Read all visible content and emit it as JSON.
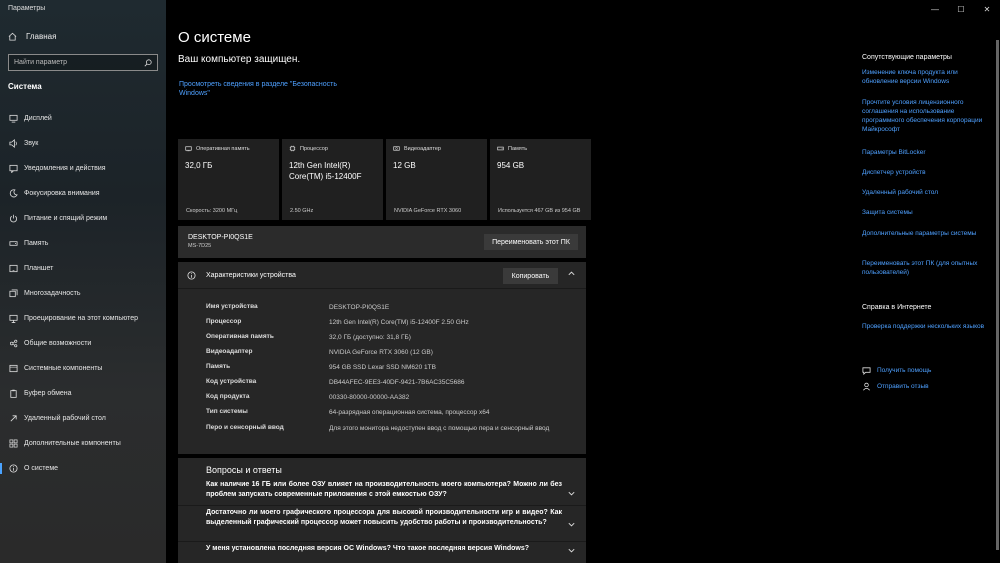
{
  "app": {
    "title": "Параметры"
  },
  "window": {
    "minimize": "—",
    "maximize": "☐",
    "close": "✕"
  },
  "sidebar": {
    "home_label": "Главная",
    "search_placeholder": "Найти параметр",
    "section_title": "Система",
    "items": [
      {
        "label": "Дисплей",
        "icon": "monitor-icon"
      },
      {
        "label": "Звук",
        "icon": "speaker-icon"
      },
      {
        "label": "Уведомления и действия",
        "icon": "notification-icon"
      },
      {
        "label": "Фокусировка внимания",
        "icon": "moon-icon"
      },
      {
        "label": "Питание и спящий режим",
        "icon": "power-icon"
      },
      {
        "label": "Память",
        "icon": "storage-icon"
      },
      {
        "label": "Планшет",
        "icon": "tablet-icon"
      },
      {
        "label": "Многозадачность",
        "icon": "multitask-icon"
      },
      {
        "label": "Проецирование на этот компьютер",
        "icon": "project-icon"
      },
      {
        "label": "Общие возможности",
        "icon": "shared-icon"
      },
      {
        "label": "Системные компоненты",
        "icon": "components-icon"
      },
      {
        "label": "Буфер обмена",
        "icon": "clipboard-icon"
      },
      {
        "label": "Удаленный рабочий стол",
        "icon": "remote-icon"
      },
      {
        "label": "Дополнительные компоненты",
        "icon": "grid-icon"
      },
      {
        "label": "О системе",
        "icon": "info-icon"
      }
    ]
  },
  "main": {
    "title": "О системе",
    "protected_text": "Ваш компьютер защищен.",
    "security_link": "Просмотреть сведения в разделе \"Безопасность Windows\"",
    "cards": [
      {
        "header": "Оперативная память",
        "value": "32,0 ГБ",
        "sub": "Скорость: 3200 МГц"
      },
      {
        "header": "Процессор",
        "value": "12th Gen Intel(R) Core(TM) i5-12400F",
        "sub": "2.50 GHz"
      },
      {
        "header": "Видеоадаптер",
        "value": "12 GB",
        "sub": "NVIDIA GeForce RTX 3060"
      },
      {
        "header": "Память",
        "value": "954 GB",
        "sub": "Используется 467 GB из 954 GB"
      }
    ],
    "pc_name": "DESKTOP-PI0QS1E",
    "pc_model": "MS-7D25",
    "rename_button": "Переименовать этот ПК",
    "specs_title": "Характеристики устройства",
    "copy_button": "Копировать",
    "specs": [
      {
        "key": "Имя устройства",
        "value": "DESKTOP-PI0QS1E"
      },
      {
        "key": "Процессор",
        "value": "12th Gen Intel(R) Core(TM) i5-12400F   2.50 GHz"
      },
      {
        "key": "Оперативная память",
        "value": "32,0 ГБ (доступно: 31,8 ГБ)"
      },
      {
        "key": "Видеоадаптер",
        "value": "NVIDIA GeForce RTX 3060 (12 GB)"
      },
      {
        "key": "Память",
        "value": "954 GB SSD Lexar SSD NM620 1TB"
      },
      {
        "key": "Код устройства",
        "value": "DB44AFEC-9EE3-40DF-9421-7B6AC35C5686"
      },
      {
        "key": "Код продукта",
        "value": "00330-80000-00000-AA382"
      },
      {
        "key": "Тип системы",
        "value": "64-разрядная операционная система, процессор x64"
      },
      {
        "key": "Перо и сенсорный ввод",
        "value": "Для этого монитора недоступен ввод с помощью пера и сенсорный ввод"
      }
    ],
    "faq_title": "Вопросы и ответы",
    "faq": [
      "Как наличие 16 ГБ или более ОЗУ влияет на производительность моего компьютера? Можно ли без проблем запускать современные приложения с этой емкостью ОЗУ?",
      "Достаточно ли моего графического процессора для высокой производительности игр и видео? Как выделенный графический процессор может повысить удобство работы и производительность?",
      "У меня установлена последняя версия ОС Windows? Что такое последняя версия Windows?"
    ]
  },
  "right": {
    "related_title": "Сопутствующие параметры",
    "related_links": [
      "Изменение ключа продукта или обновление версии Windows",
      "Прочтите условия лицензионного соглашения на использование программного обеспечения корпорации Майкрософт",
      "Параметры BitLocker",
      "Диспетчер устройств",
      "Удаленный рабочий стол",
      "Защита системы",
      "Дополнительные параметры системы",
      "Переименовать этот ПК (для опытных пользователей)"
    ],
    "help_title": "Справка в Интернете",
    "help_link": "Проверка поддержки нескольких языков",
    "get_help": "Получить помощь",
    "feedback": "Отправить отзыв"
  },
  "colors": {
    "accent": "#4ea0ff",
    "background": "#000000",
    "card": "#202020"
  }
}
